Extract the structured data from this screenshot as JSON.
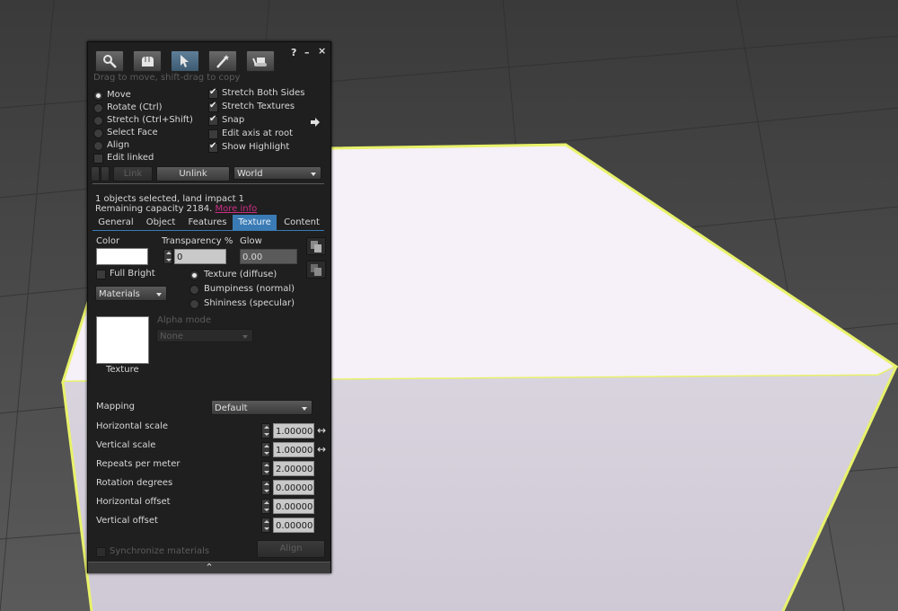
{
  "colors": {
    "accent": "#3a7bb5",
    "link": "#cc2f86",
    "panel_bg": "#1f1f1f"
  },
  "header": {
    "tools": [
      {
        "name": "focus-tool-button",
        "icon": "magnifier-icon",
        "active": false
      },
      {
        "name": "move-tool-button",
        "icon": "grab-hand-icon",
        "active": false
      },
      {
        "name": "edit-tool-button",
        "icon": "pointer-arrow-icon",
        "active": true
      },
      {
        "name": "create-tool-button",
        "icon": "magic-wand-icon",
        "active": false
      },
      {
        "name": "land-tool-button",
        "icon": "bulldozer-icon",
        "active": false
      }
    ],
    "help": "?",
    "minimize": "–",
    "close": "×"
  },
  "hint": "Drag to move, shift-drag to copy",
  "modes": {
    "move": "Move",
    "rotate": "Rotate (Ctrl)",
    "stretch": "Stretch (Ctrl+Shift)",
    "select_face": "Select Face",
    "align": "Align",
    "edit_linked": "Edit linked",
    "selected": "move"
  },
  "options": {
    "stretch_both_sides": "Stretch Both Sides",
    "stretch_textures": "Stretch Textures",
    "snap": "Snap",
    "edit_axis_root": "Edit axis at root",
    "show_highlight": "Show Highlight"
  },
  "link_row": {
    "link": "Link",
    "unlink": "Unlink",
    "coord": "World"
  },
  "selection": {
    "line1": "1 objects selected, land impact 1",
    "line2": "Remaining capacity 2184.",
    "more_info": "More info"
  },
  "tabs": [
    "General",
    "Object",
    "Features",
    "Texture",
    "Content"
  ],
  "active_tab": "Texture",
  "texture": {
    "color_label": "Color",
    "transparency_label": "Transparency %",
    "transparency_value": "0",
    "glow_label": "Glow",
    "glow_value": "0.00",
    "full_bright": "Full Bright",
    "materials_combo": "Materials",
    "tex_diffuse": "Texture (diffuse)",
    "bumpiness": "Bumpiness (normal)",
    "shininess": "Shininess (specular)",
    "texture_label": "Texture",
    "alpha_mode_label": "Alpha mode",
    "alpha_mode_value": "None",
    "mapping_label": "Mapping",
    "mapping_value": "Default",
    "rows": [
      {
        "label": "Horizontal scale",
        "value": "1.00000"
      },
      {
        "label": "Vertical scale",
        "value": "1.00000"
      },
      {
        "label": "Repeats per meter",
        "value": "2.00000"
      },
      {
        "label": "Rotation degrees",
        "value": "0.00000"
      },
      {
        "label": "Horizontal offset",
        "value": "0.00000"
      },
      {
        "label": "Vertical offset",
        "value": "0.00000"
      }
    ],
    "sync_materials": "Synchronize materials",
    "align": "Align"
  },
  "expand_glyph": "⌃"
}
